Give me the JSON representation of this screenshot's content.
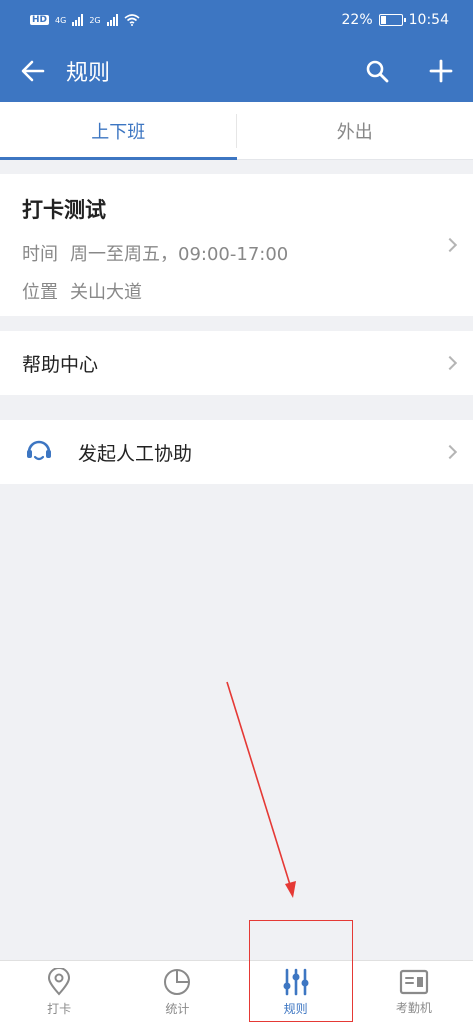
{
  "status_bar": {
    "network_left": "HD",
    "network_4g": "4G",
    "network_2g": "2G",
    "battery": "22%",
    "time": "10:54"
  },
  "appbar": {
    "title": "规则",
    "back_icon": "arrow-left-icon",
    "search_icon": "search-icon",
    "add_icon": "plus-icon"
  },
  "tabs": [
    {
      "label": "上下班",
      "active": true
    },
    {
      "label": "外出",
      "active": false
    }
  ],
  "rule": {
    "title": "打卡测试",
    "time_label": "时间",
    "time_value": "周一至周五，09:00-17:00",
    "location_label": "位置",
    "location_value": "关山大道"
  },
  "help_center": {
    "label": "帮助中心"
  },
  "assist": {
    "label": "发起人工协助",
    "icon": "headset-icon"
  },
  "bottom_nav": [
    {
      "label": "打卡",
      "icon": "location-pin-icon",
      "active": false
    },
    {
      "label": "统计",
      "icon": "pie-chart-icon",
      "active": false
    },
    {
      "label": "规则",
      "icon": "sliders-icon",
      "active": true
    },
    {
      "label": "考勤机",
      "icon": "attendance-machine-icon",
      "active": false
    }
  ],
  "colors": {
    "brand": "#3d76c2",
    "background": "#f0f1f4",
    "annotation": "#e53935"
  }
}
